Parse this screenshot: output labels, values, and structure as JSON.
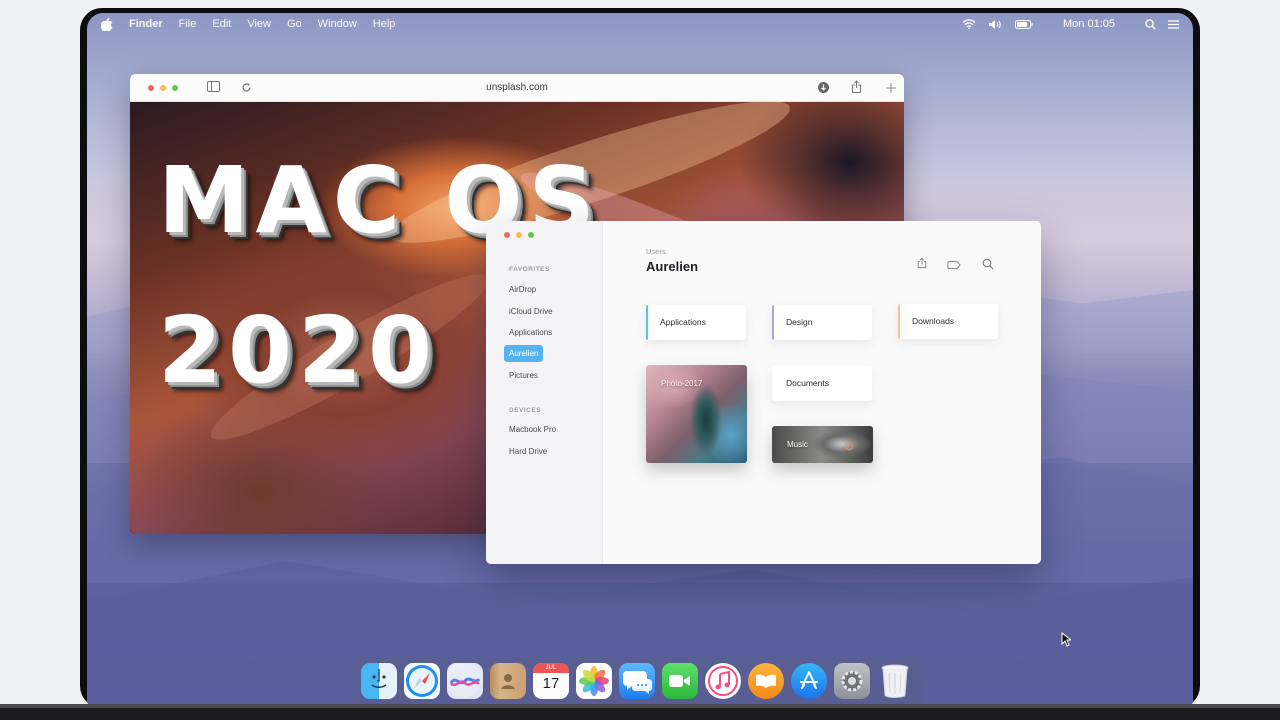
{
  "menubar": {
    "app_name": "Finder",
    "menus": [
      "File",
      "Edit",
      "View",
      "Go",
      "Window",
      "Help"
    ],
    "clock": "Mon 01:05",
    "status_icons": [
      "wifi-icon",
      "volume-icon",
      "battery-icon",
      "search-icon",
      "menu-list-icon"
    ]
  },
  "safari": {
    "url": "unsplash.com",
    "toolbar_icons": [
      "sidebar-icon",
      "reload-icon",
      "download-icon",
      "share-icon",
      "new-tab-icon"
    ],
    "overlay_title_line1": "MAC OS",
    "overlay_title_line2": "2020"
  },
  "finder": {
    "sidebar": {
      "favorites_heading": "FAVORITES",
      "favorites": [
        "AirDrop",
        "iCloud Drive",
        "Applications",
        "Aurelien",
        "Pictures"
      ],
      "active_item": "Aurelien",
      "devices_heading": "DEVICES",
      "devices": [
        "Macbook Pro",
        "Hard Drive"
      ]
    },
    "breadcrumb": "Users",
    "title": "Aurelien",
    "toolbar_icons": [
      "share-icon",
      "tag-icon",
      "search-icon"
    ],
    "folders": [
      {
        "label": "Applications",
        "accent": "#5bc2e7"
      },
      {
        "label": "Design",
        "accent": "#a9a6dc"
      },
      {
        "label": "Downloads",
        "accent": "#f2c29a"
      },
      {
        "label": "Documents",
        "accent": ""
      },
      {
        "label": "Photo-2017",
        "accent": ""
      },
      {
        "label": "Music",
        "accent": ""
      }
    ]
  },
  "dock": {
    "apps": [
      "finder-icon",
      "safari-icon",
      "siri-icon",
      "contacts-icon",
      "calendar-icon",
      "photos-icon",
      "messages-icon",
      "facetime-icon",
      "itunes-icon",
      "ibooks-icon",
      "app-store-icon",
      "system-preferences-icon",
      "trash-icon"
    ],
    "calendar_month": "JUL",
    "calendar_day": "17"
  },
  "colors": {
    "close": "#ee6a5f",
    "minimize": "#f5be4f",
    "zoom": "#61c554",
    "sidebar_active": "#55b3f0"
  }
}
